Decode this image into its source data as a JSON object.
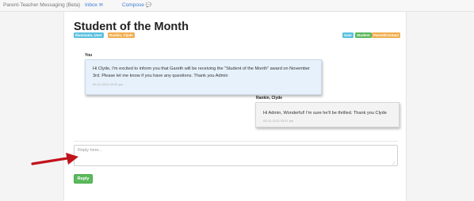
{
  "topbar": {
    "brand": "Parent-Teacher Messaging (Beta)",
    "inbox_label": "Inbox",
    "inbox_icon": "envelope-icon",
    "compose_label": "Compose",
    "compose_icon": "speech-bubble-icon"
  },
  "thread": {
    "title": "Student of the Month",
    "tags": [
      "Illuminate, User",
      "Rankin, Clyde"
    ],
    "roles": [
      "User",
      "Student",
      "Parent/Contact"
    ]
  },
  "messages": [
    {
      "sender": "You",
      "text": "Hi Clyde, I'm excited to inform you that Gareth will be receiving the \"Student of the Month\" award on November 3rd. Please let me know if you have any questions. Thank you Admin",
      "timestamp": "09-10-2013 03:30 pm"
    },
    {
      "sender": "Rankin, Clyde",
      "text": "Hi Admin, Wonderful! I'm sure he'll be thrilled. Thank you Clyde",
      "timestamp": "09-10-2013 03:37 pm"
    }
  ],
  "reply": {
    "placeholder": "Reply here...",
    "button_label": "Reply"
  },
  "colors": {
    "info_badge": "#5bc0de",
    "warning_badge": "#f0ad4e",
    "success": "#5cb85c",
    "annotation_arrow": "#c0141b",
    "link": "#3a7bd5"
  }
}
